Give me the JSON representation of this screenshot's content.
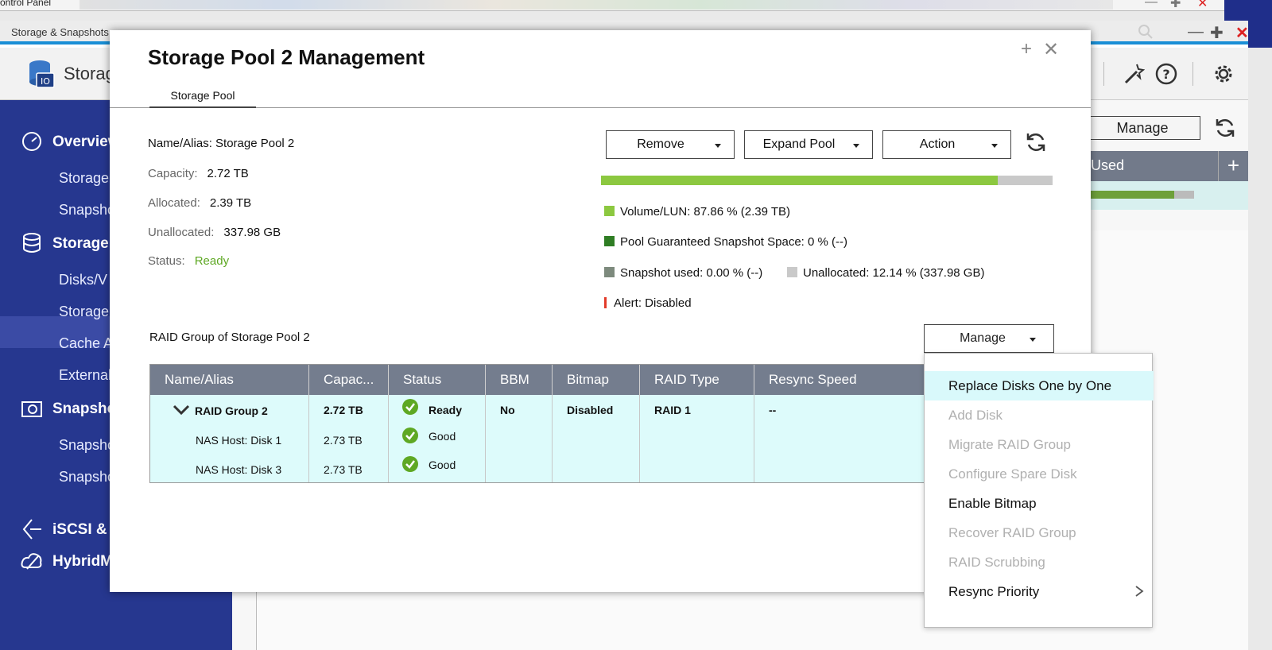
{
  "control_panel": {
    "title": "ontrol Panel"
  },
  "app": {
    "window_title": "Storage & Snapshots",
    "brand": "Storag",
    "sidebar": {
      "items": [
        {
          "label": "Overview",
          "major": true
        },
        {
          "label": "Storage"
        },
        {
          "label": "Snapsho"
        },
        {
          "label": "Storage",
          "major": true
        },
        {
          "label": "Disks/V"
        },
        {
          "label": "Storage"
        },
        {
          "label": "Cache A"
        },
        {
          "label": "External"
        },
        {
          "label": "Snapsho",
          "major": true
        },
        {
          "label": "Snapsho"
        },
        {
          "label": "Snapsho"
        },
        {
          "label": "iSCSI & F",
          "major": true
        },
        {
          "label": "HybridM",
          "major": true
        }
      ]
    },
    "background": {
      "manage_label": "Manage",
      "used_header": "Used",
      "add_symbol": "+"
    }
  },
  "modal": {
    "title": "Storage Pool 2 Management",
    "tab": "Storage Pool",
    "info": {
      "name_alias": "Name/Alias: Storage Pool 2",
      "capacity_label": "Capacity:",
      "capacity_value": "2.72 TB",
      "allocated_label": "Allocated:",
      "allocated_value": "2.39 TB",
      "unallocated_label": "Unallocated:",
      "unallocated_value": "337.98 GB",
      "status_label": "Status:",
      "status_value": "Ready"
    },
    "buttons": {
      "remove": "Remove",
      "expand": "Expand Pool",
      "action": "Action"
    },
    "usage": {
      "volume_fraction": 0.8786
    },
    "legend": {
      "volume": "Volume/LUN: 87.86 % (2.39 TB)",
      "guaranteed": "Pool Guaranteed Snapshot Space: 0 % (--)",
      "snapshot": "Snapshot used: 0.00 % (--)",
      "unallocated": "Unallocated: 12.14 % (337.98 GB)",
      "alert": "Alert: Disabled"
    },
    "colors": {
      "volume": "#8cc840",
      "guaranteed": "#2f7d24",
      "snapshot": "#7d8a7d",
      "unallocated": "#c9c9c9",
      "ready": "#5ea823"
    },
    "raid_title": "RAID Group of Storage Pool 2",
    "manage": "Manage",
    "table": {
      "headers": [
        "Name/Alias",
        "Capac...",
        "Status",
        "BBM",
        "Bitmap",
        "RAID Type",
        "Resync Speed"
      ],
      "group": {
        "name": "RAID Group 2",
        "capacity": "2.72 TB",
        "status": "Ready",
        "bbm": "No",
        "bitmap": "Disabled",
        "raid_type": "RAID 1",
        "resync": "--"
      },
      "disks": [
        {
          "name": "NAS Host: Disk 1",
          "capacity": "2.73 TB",
          "status": "Good"
        },
        {
          "name": "NAS Host: Disk 3",
          "capacity": "2.73 TB",
          "status": "Good"
        }
      ]
    },
    "menu": [
      {
        "label": "Replace Disks One by One",
        "state": "hover"
      },
      {
        "label": "Add Disk",
        "state": "disabled"
      },
      {
        "label": "Migrate RAID Group",
        "state": "disabled"
      },
      {
        "label": "Configure Spare Disk",
        "state": "disabled"
      },
      {
        "label": "Enable Bitmap",
        "state": "enabled"
      },
      {
        "label": "Recover RAID Group",
        "state": "disabled"
      },
      {
        "label": "RAID Scrubbing",
        "state": "disabled"
      },
      {
        "label": "Resync Priority",
        "state": "submenu"
      }
    ]
  }
}
